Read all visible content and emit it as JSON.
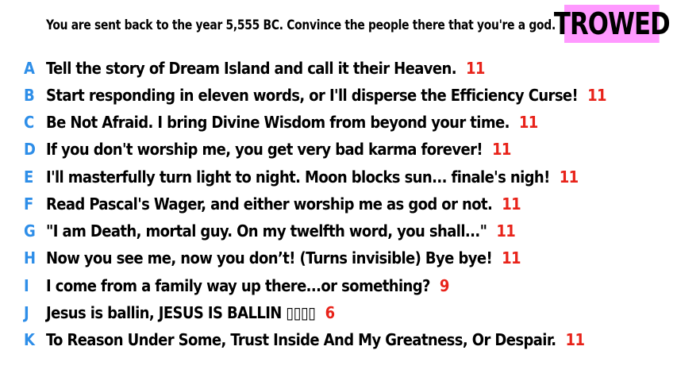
{
  "prompt": "You are sent back to the year 5,555 BC. Convince the people there that you're a god.",
  "badge": "TROWED",
  "answers": [
    {
      "letter": "A",
      "text": "Tell the story of Dream Island and call it their Heaven.",
      "count": "11"
    },
    {
      "letter": "B",
      "text": "Start responding in eleven words, or I'll disperse the Efficiency Curse!",
      "count": "11"
    },
    {
      "letter": "C",
      "text": "Be Not Afraid. I bring Divine Wisdom from beyond your time.",
      "count": "11"
    },
    {
      "letter": "D",
      "text": "If you don't worship me, you get very bad karma forever!",
      "count": "11"
    },
    {
      "letter": "E",
      "text": "I'll masterfully turn light to night. Moon blocks sun... finale's nigh!",
      "count": "11"
    },
    {
      "letter": "F",
      "text": "Read Pascal's Wager, and either worship me as god or not.",
      "count": "11"
    },
    {
      "letter": "G",
      "text": "\"I am Death, mortal guy. On my twelfth word, you shall...\"",
      "count": "11"
    },
    {
      "letter": "H",
      "text": "Now you see me, now you don’t! (Turns invisible) Bye bye!",
      "count": "11"
    },
    {
      "letter": "I",
      "text": "I come from a family way up there...or something?",
      "count": "9"
    },
    {
      "letter": "J",
      "text": "Jesus is ballin, JESUS IS BALLIN ▯▯▯▯",
      "count": "6"
    },
    {
      "letter": "K",
      "text": "To Reason Under Some, Trust Inside And My Greatness, Or Despair.",
      "count": "11"
    }
  ],
  "colors": {
    "letter": "#2e8ee8",
    "count": "#e8231a",
    "badge_bg": "#ff99ff"
  }
}
